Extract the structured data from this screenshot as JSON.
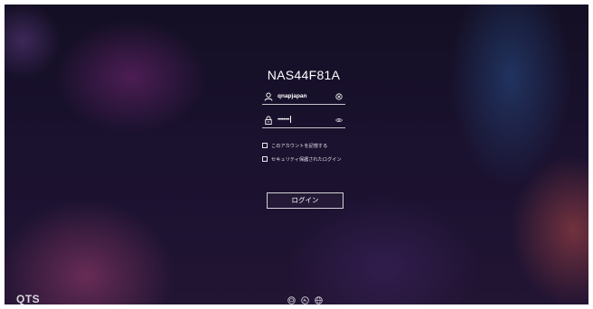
{
  "device": {
    "name": "NAS44F81A"
  },
  "login_form": {
    "username": {
      "value": "qnapjapan",
      "lead_icon": "user-icon",
      "clear_icon": "clear-icon"
    },
    "password": {
      "value": "••••••••",
      "lead_icon": "lock-icon",
      "reveal_icon": "eye-icon"
    },
    "remember": {
      "label": "このアカウントを記憶する",
      "checked": false
    },
    "secure_login": {
      "label": "セキュリティ保護されたログイン",
      "checked": false
    },
    "submit_label": "ログイン"
  },
  "brand": {
    "label": "QTS"
  },
  "footer": {
    "icons": [
      "qfinder-icon",
      "help-icon",
      "language-icon"
    ]
  },
  "colors": {
    "text": "#ffffff",
    "background_dark": "#140f24"
  }
}
